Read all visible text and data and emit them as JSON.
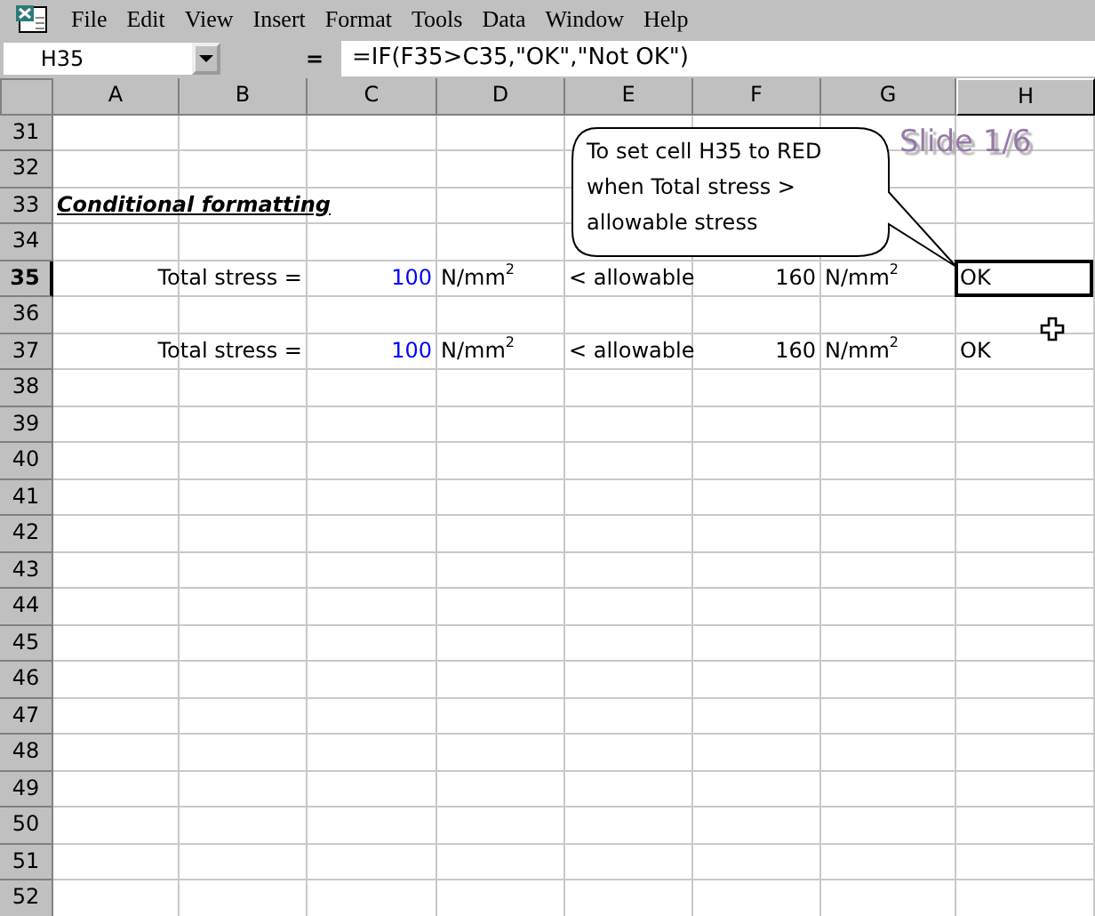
{
  "menu": [
    {
      "label": "File",
      "selected": false
    },
    {
      "label": "Edit",
      "selected": false
    },
    {
      "label": "View",
      "selected": false
    },
    {
      "label": "Insert",
      "selected": false
    },
    {
      "label": "Format",
      "selected": false
    },
    {
      "label": "Tools",
      "selected": false
    },
    {
      "label": "Data",
      "selected": false
    },
    {
      "label": "Window",
      "selected": false
    },
    {
      "label": "Help",
      "selected": false
    }
  ],
  "formula_bar": {
    "name_box": "H35",
    "equals": "=",
    "formula": "=IF(F35>C35,\"OK\",\"Not OK\")"
  },
  "columns": [
    {
      "label": "A",
      "selected": false
    },
    {
      "label": "B",
      "selected": false
    },
    {
      "label": "C",
      "selected": false
    },
    {
      "label": "D",
      "selected": false
    },
    {
      "label": "E",
      "selected": false
    },
    {
      "label": "F",
      "selected": false
    },
    {
      "label": "G",
      "selected": false
    },
    {
      "label": "H",
      "selected": true
    }
  ],
  "rows": [
    {
      "number": "31",
      "selected": false
    },
    {
      "number": "32",
      "selected": false
    },
    {
      "number": "33",
      "selected": false,
      "cells": {
        "A": {
          "kind": "heading",
          "text": "Conditional formatting",
          "selected": false
        }
      }
    },
    {
      "number": "34",
      "selected": false
    },
    {
      "number": "35",
      "selected": true,
      "cells": {
        "B": {
          "kind": "label",
          "text": "Total stress =",
          "selected": false
        },
        "C": {
          "kind": "number",
          "text": "100",
          "selected": false
        },
        "D": {
          "kind": "text",
          "text": "N/mm$^{2}$",
          "selected": false
        },
        "E": {
          "kind": "text",
          "text": "< allowable",
          "selected": false
        },
        "F": {
          "kind": "label",
          "text": "160",
          "selected": false
        },
        "G": {
          "kind": "text",
          "text": "N/mm$^{2}$",
          "selected": false
        },
        "H": {
          "kind": "text",
          "text": "OK",
          "selected": true
        }
      }
    },
    {
      "number": "36",
      "selected": false
    },
    {
      "number": "37",
      "selected": false,
      "cells": {
        "B": {
          "kind": "label",
          "text": "Total stress =",
          "selected": false
        },
        "C": {
          "kind": "number",
          "text": "100",
          "selected": false
        },
        "D": {
          "kind": "text",
          "text": "N/mm$^{2}$",
          "selected": false
        },
        "E": {
          "kind": "text",
          "text": "< allowable",
          "selected": false
        },
        "F": {
          "kind": "label",
          "text": "160",
          "selected": false
        },
        "G": {
          "kind": "text",
          "text": "N/mm$^{2}$",
          "selected": false
        },
        "H": {
          "kind": "text",
          "text": "OK",
          "selected": false
        }
      }
    },
    {
      "number": "38",
      "selected": false
    },
    {
      "number": "39",
      "selected": false
    },
    {
      "number": "40",
      "selected": false
    },
    {
      "number": "41",
      "selected": false
    },
    {
      "number": "42",
      "selected": false
    },
    {
      "number": "43",
      "selected": false
    },
    {
      "number": "44",
      "selected": false
    },
    {
      "number": "45",
      "selected": false
    },
    {
      "number": "46",
      "selected": false
    },
    {
      "number": "47",
      "selected": false
    },
    {
      "number": "48",
      "selected": false
    },
    {
      "number": "49",
      "selected": false
    },
    {
      "number": "50",
      "selected": false
    },
    {
      "number": "51",
      "selected": false
    },
    {
      "number": "52",
      "selected": false
    }
  ],
  "callout": {
    "text": "To set cell H35 to RED when Total stress > allowable stress"
  },
  "slide_label": "Slide 1/6"
}
